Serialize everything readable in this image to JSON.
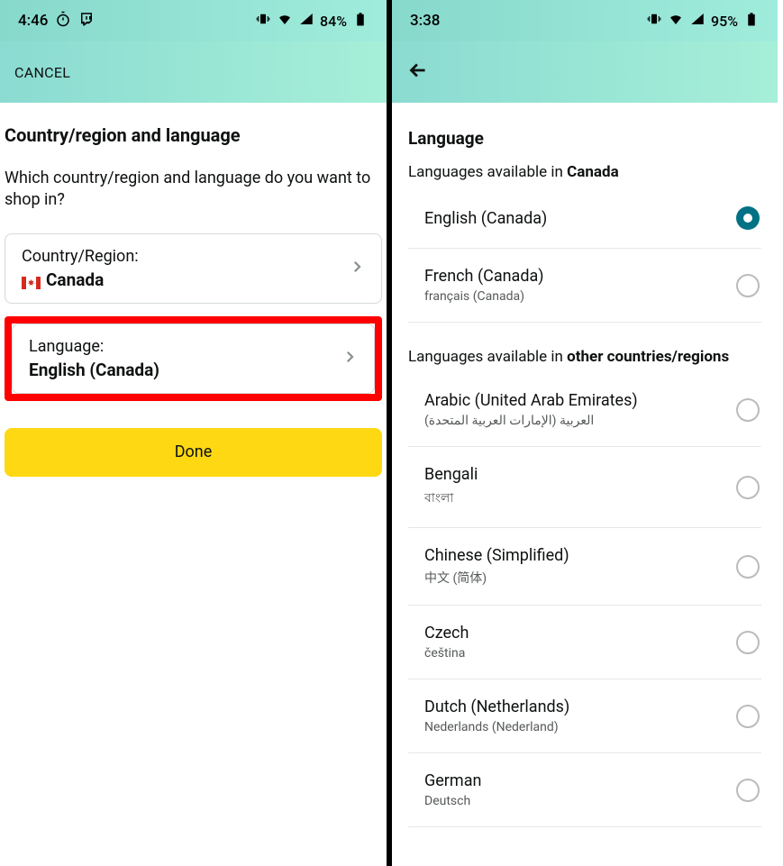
{
  "left": {
    "status": {
      "time": "4:46",
      "battery": "84%"
    },
    "cancel": "CANCEL",
    "title": "Country/region and language",
    "subtitle": "Which country/region and language do you want to shop in?",
    "countryCard": {
      "label": "Country/Region:",
      "value": "Canada"
    },
    "languageCard": {
      "label": "Language:",
      "value": "English (Canada)"
    },
    "doneButton": "Done"
  },
  "right": {
    "status": {
      "time": "3:38",
      "battery": "95%"
    },
    "heading": "Language",
    "section1_prefix": "Languages available in ",
    "section1_bold": "Canada",
    "section2_prefix": "Languages available in ",
    "section2_bold": "other countries/regions",
    "langs_canada": [
      {
        "name": "English (Canada)",
        "native": "",
        "selected": true
      },
      {
        "name": "French (Canada)",
        "native": "français (Canada)",
        "selected": false
      }
    ],
    "langs_other": [
      {
        "name": "Arabic (United Arab Emirates)",
        "native": "العربية (الإمارات العربية المتحدة)",
        "selected": false
      },
      {
        "name": "Bengali",
        "native": "বাংলা",
        "selected": false
      },
      {
        "name": "Chinese (Simplified)",
        "native": "中文 (简体)",
        "selected": false
      },
      {
        "name": "Czech",
        "native": "čeština",
        "selected": false
      },
      {
        "name": "Dutch (Netherlands)",
        "native": "Nederlands (Nederland)",
        "selected": false
      },
      {
        "name": "German",
        "native": "Deutsch",
        "selected": false
      }
    ]
  }
}
